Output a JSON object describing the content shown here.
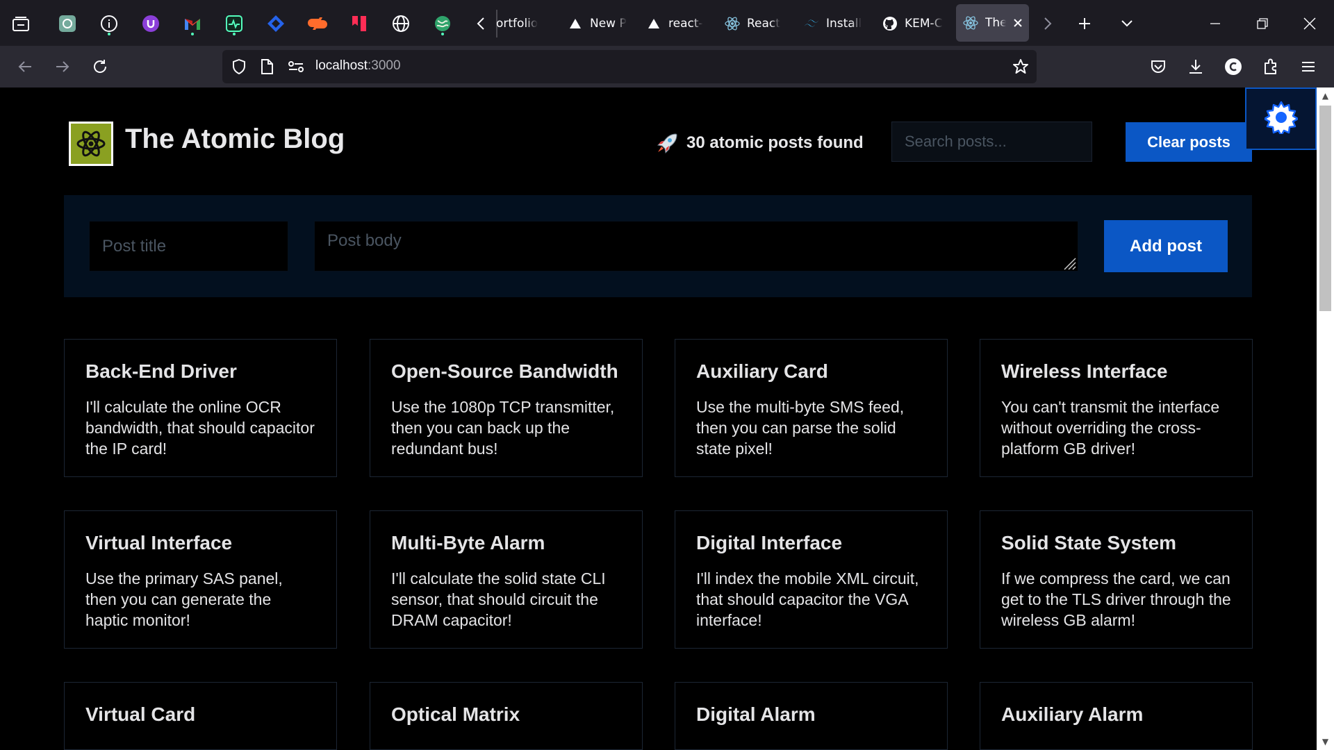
{
  "browser": {
    "pinned_tabs": [
      {
        "name": "tab-list-icon"
      },
      {
        "name": "chatgpt-icon"
      },
      {
        "name": "info-icon"
      },
      {
        "name": "ublock-icon"
      },
      {
        "name": "gmail-icon"
      },
      {
        "name": "activity-icon"
      },
      {
        "name": "diamond-icon"
      },
      {
        "name": "cpanel-icon"
      },
      {
        "name": "bookmark-app-icon"
      },
      {
        "name": "globe-icon"
      },
      {
        "name": "world-icon"
      }
    ],
    "tabs": [
      {
        "title": "ortfolio",
        "icon": "none"
      },
      {
        "title": "New P",
        "icon": "vercel-icon"
      },
      {
        "title": "react-",
        "icon": "vercel-icon"
      },
      {
        "title": "React",
        "icon": "react-icon"
      },
      {
        "title": "Install",
        "icon": "tailwind-icon"
      },
      {
        "title": "KEM-C",
        "icon": "github-icon"
      },
      {
        "title": "The",
        "icon": "react-icon",
        "active": true
      }
    ],
    "url_host": "localhost",
    "url_port": ":3000"
  },
  "header": {
    "site_title": "The Atomic Blog",
    "posts_found": "30 atomic posts found",
    "search_placeholder": "Search posts...",
    "clear_label": "Clear posts"
  },
  "form": {
    "title_placeholder": "Post title",
    "body_placeholder": "Post body",
    "add_label": "Add post"
  },
  "posts": [
    {
      "title": "Back-End Driver",
      "body": "I'll calculate the online OCR bandwidth, that should capacitor the IP card!"
    },
    {
      "title": "Open-Source Bandwidth",
      "body": "Use the 1080p TCP transmitter, then you can back up the redundant bus!"
    },
    {
      "title": "Auxiliary Card",
      "body": "Use the multi-byte SMS feed, then you can parse the solid state pixel!"
    },
    {
      "title": "Wireless Interface",
      "body": "You can't transmit the interface without overriding the cross-platform GB driver!"
    },
    {
      "title": "Virtual Interface",
      "body": "Use the primary SAS panel, then you can generate the haptic monitor!"
    },
    {
      "title": "Multi-Byte Alarm",
      "body": "I'll calculate the solid state CLI sensor, that should circuit the DRAM capacitor!"
    },
    {
      "title": "Digital Interface",
      "body": "I'll index the mobile XML circuit, that should capacitor the VGA interface!"
    },
    {
      "title": "Solid State System",
      "body": "If we compress the card, we can get to the TLS driver through the wireless GB alarm!"
    },
    {
      "title": "Virtual Card",
      "body": ""
    },
    {
      "title": "Optical Matrix",
      "body": ""
    },
    {
      "title": "Digital Alarm",
      "body": ""
    },
    {
      "title": "Auxiliary Alarm",
      "body": ""
    }
  ],
  "colors": {
    "accent": "#0b57c5",
    "logo_bg": "#8aa021",
    "form_panel": "#03101f",
    "page_bg": "#000000"
  }
}
